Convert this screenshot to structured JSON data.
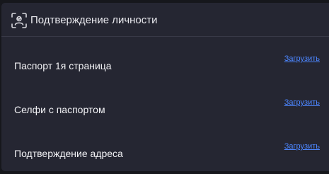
{
  "header": {
    "icon": "identity-scan-icon",
    "title": "Подтверждение личности"
  },
  "documents": [
    {
      "label": "Паспорт 1я страница",
      "action": "Загрузить"
    },
    {
      "label": "Селфи с паспортом",
      "action": "Загрузить"
    },
    {
      "label": "Подтверждение адреса",
      "action": "Загрузить"
    }
  ],
  "colors": {
    "page_bg": "#16171c",
    "panel_bg": "#252632",
    "divider": "#383a48",
    "text": "#f2f2f5",
    "link": "#4c86ff"
  }
}
